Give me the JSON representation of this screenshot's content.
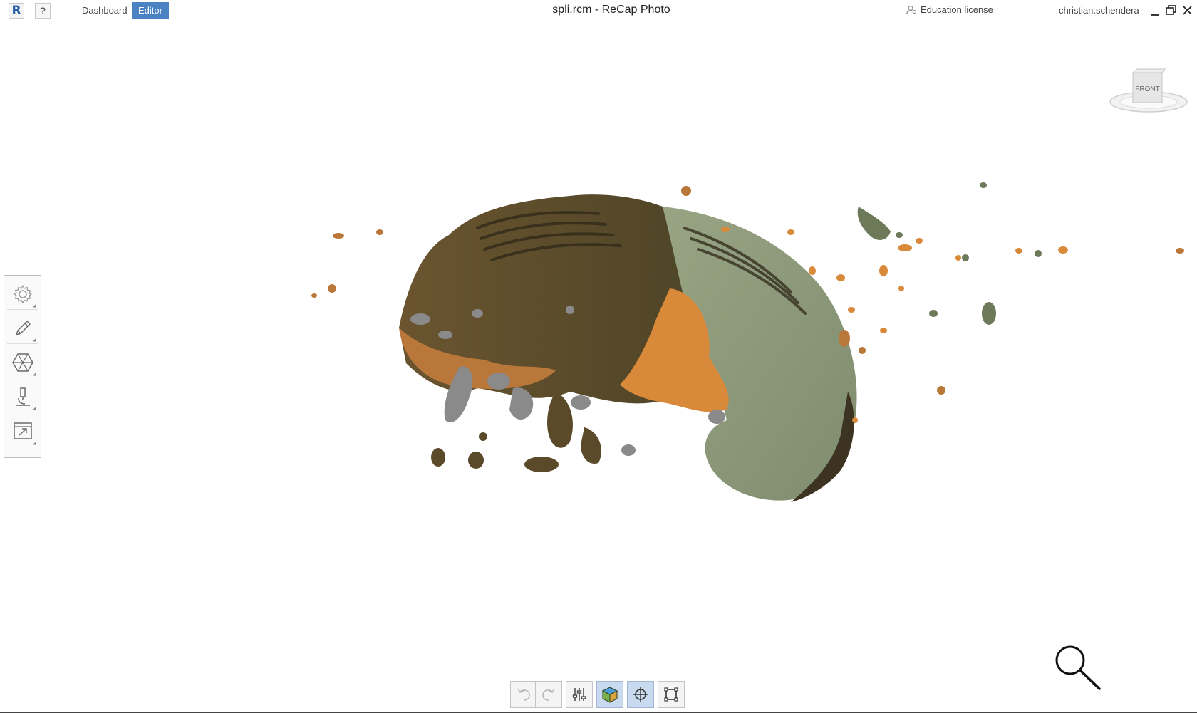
{
  "header": {
    "logo_letter": "R",
    "help_label": "?",
    "tabs": [
      {
        "label": "Dashboard",
        "active": false
      },
      {
        "label": "Editor",
        "active": true
      }
    ],
    "window_title": "spli.rcm - ReCap Photo",
    "license_label": "Education license",
    "user_name": "christian.schendera"
  },
  "viewcube": {
    "face_label": "FRONT"
  },
  "left_toolbar": {
    "items": [
      {
        "name": "settings",
        "icon": "gear-icon"
      },
      {
        "name": "edit",
        "icon": "pencil-icon"
      },
      {
        "name": "mesh",
        "icon": "hexagon-mesh-icon"
      },
      {
        "name": "analyze",
        "icon": "microscope-icon"
      },
      {
        "name": "export",
        "icon": "export-icon"
      }
    ]
  },
  "bottom_toolbar": {
    "items": [
      {
        "name": "undo",
        "icon": "undo-icon",
        "state": "disabled"
      },
      {
        "name": "redo",
        "icon": "redo-icon",
        "state": "disabled"
      },
      {
        "name": "display-settings",
        "icon": "sliders-icon",
        "state": "normal"
      },
      {
        "name": "render-mode",
        "icon": "textured-cube-icon",
        "state": "active"
      },
      {
        "name": "navigation",
        "icon": "crosshair-icon",
        "state": "active"
      },
      {
        "name": "crop",
        "icon": "crop-box-icon",
        "state": "normal"
      }
    ]
  },
  "colors": {
    "accent": "#4a82c3",
    "model_olive_dark": "#5b4a2a",
    "model_olive_light": "#8e9a78",
    "model_orange": "#d9893a",
    "model_gray": "#8a8a8a"
  }
}
